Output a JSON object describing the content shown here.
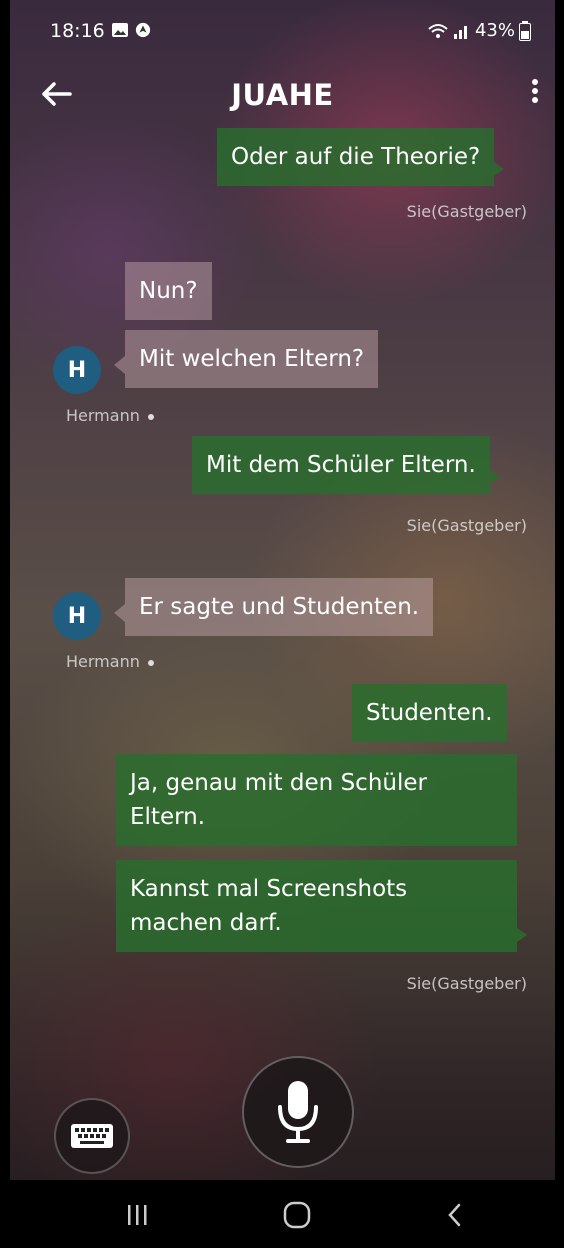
{
  "status_bar": {
    "time": "18:16",
    "battery": "43%",
    "left_icons": [
      "gallery-icon",
      "navigation-app-icon"
    ],
    "right_icons": [
      "wifi-icon",
      "signal-icon",
      "battery-icon"
    ]
  },
  "header": {
    "title": "JUAHE"
  },
  "messages": [
    {
      "direction": "outgoing",
      "text": "Oder auf die Theorie?",
      "sender_label": "Sie(Gastgeber)"
    },
    {
      "direction": "incoming",
      "text": "Nun?"
    },
    {
      "direction": "incoming",
      "text": "Mit welchen Eltern?",
      "avatar_letter": "H",
      "sender_name": "Hermann"
    },
    {
      "direction": "outgoing",
      "text": "Mit dem Schüler Eltern.",
      "sender_label": "Sie(Gastgeber)"
    },
    {
      "direction": "incoming",
      "text": "Er sagte und Studenten.",
      "avatar_letter": "H",
      "sender_name": "Hermann"
    },
    {
      "direction": "outgoing",
      "text": "Studenten."
    },
    {
      "direction": "outgoing",
      "text": "Ja, genau mit den Schüler Eltern."
    },
    {
      "direction": "outgoing",
      "text": "Kannst mal Screenshots machen darf.",
      "sender_label": "Sie(Gastgeber)"
    }
  ],
  "controls": {
    "keyboard_icon": "keyboard-icon",
    "mic_icon": "microphone-icon"
  },
  "nav_bar": {
    "items": [
      "recents-icon",
      "home-icon",
      "back-icon"
    ]
  },
  "colors": {
    "outgoing_bubble": "#286e2d",
    "incoming_bubble": "#c8aaaf",
    "avatar": "#1f5e80"
  }
}
